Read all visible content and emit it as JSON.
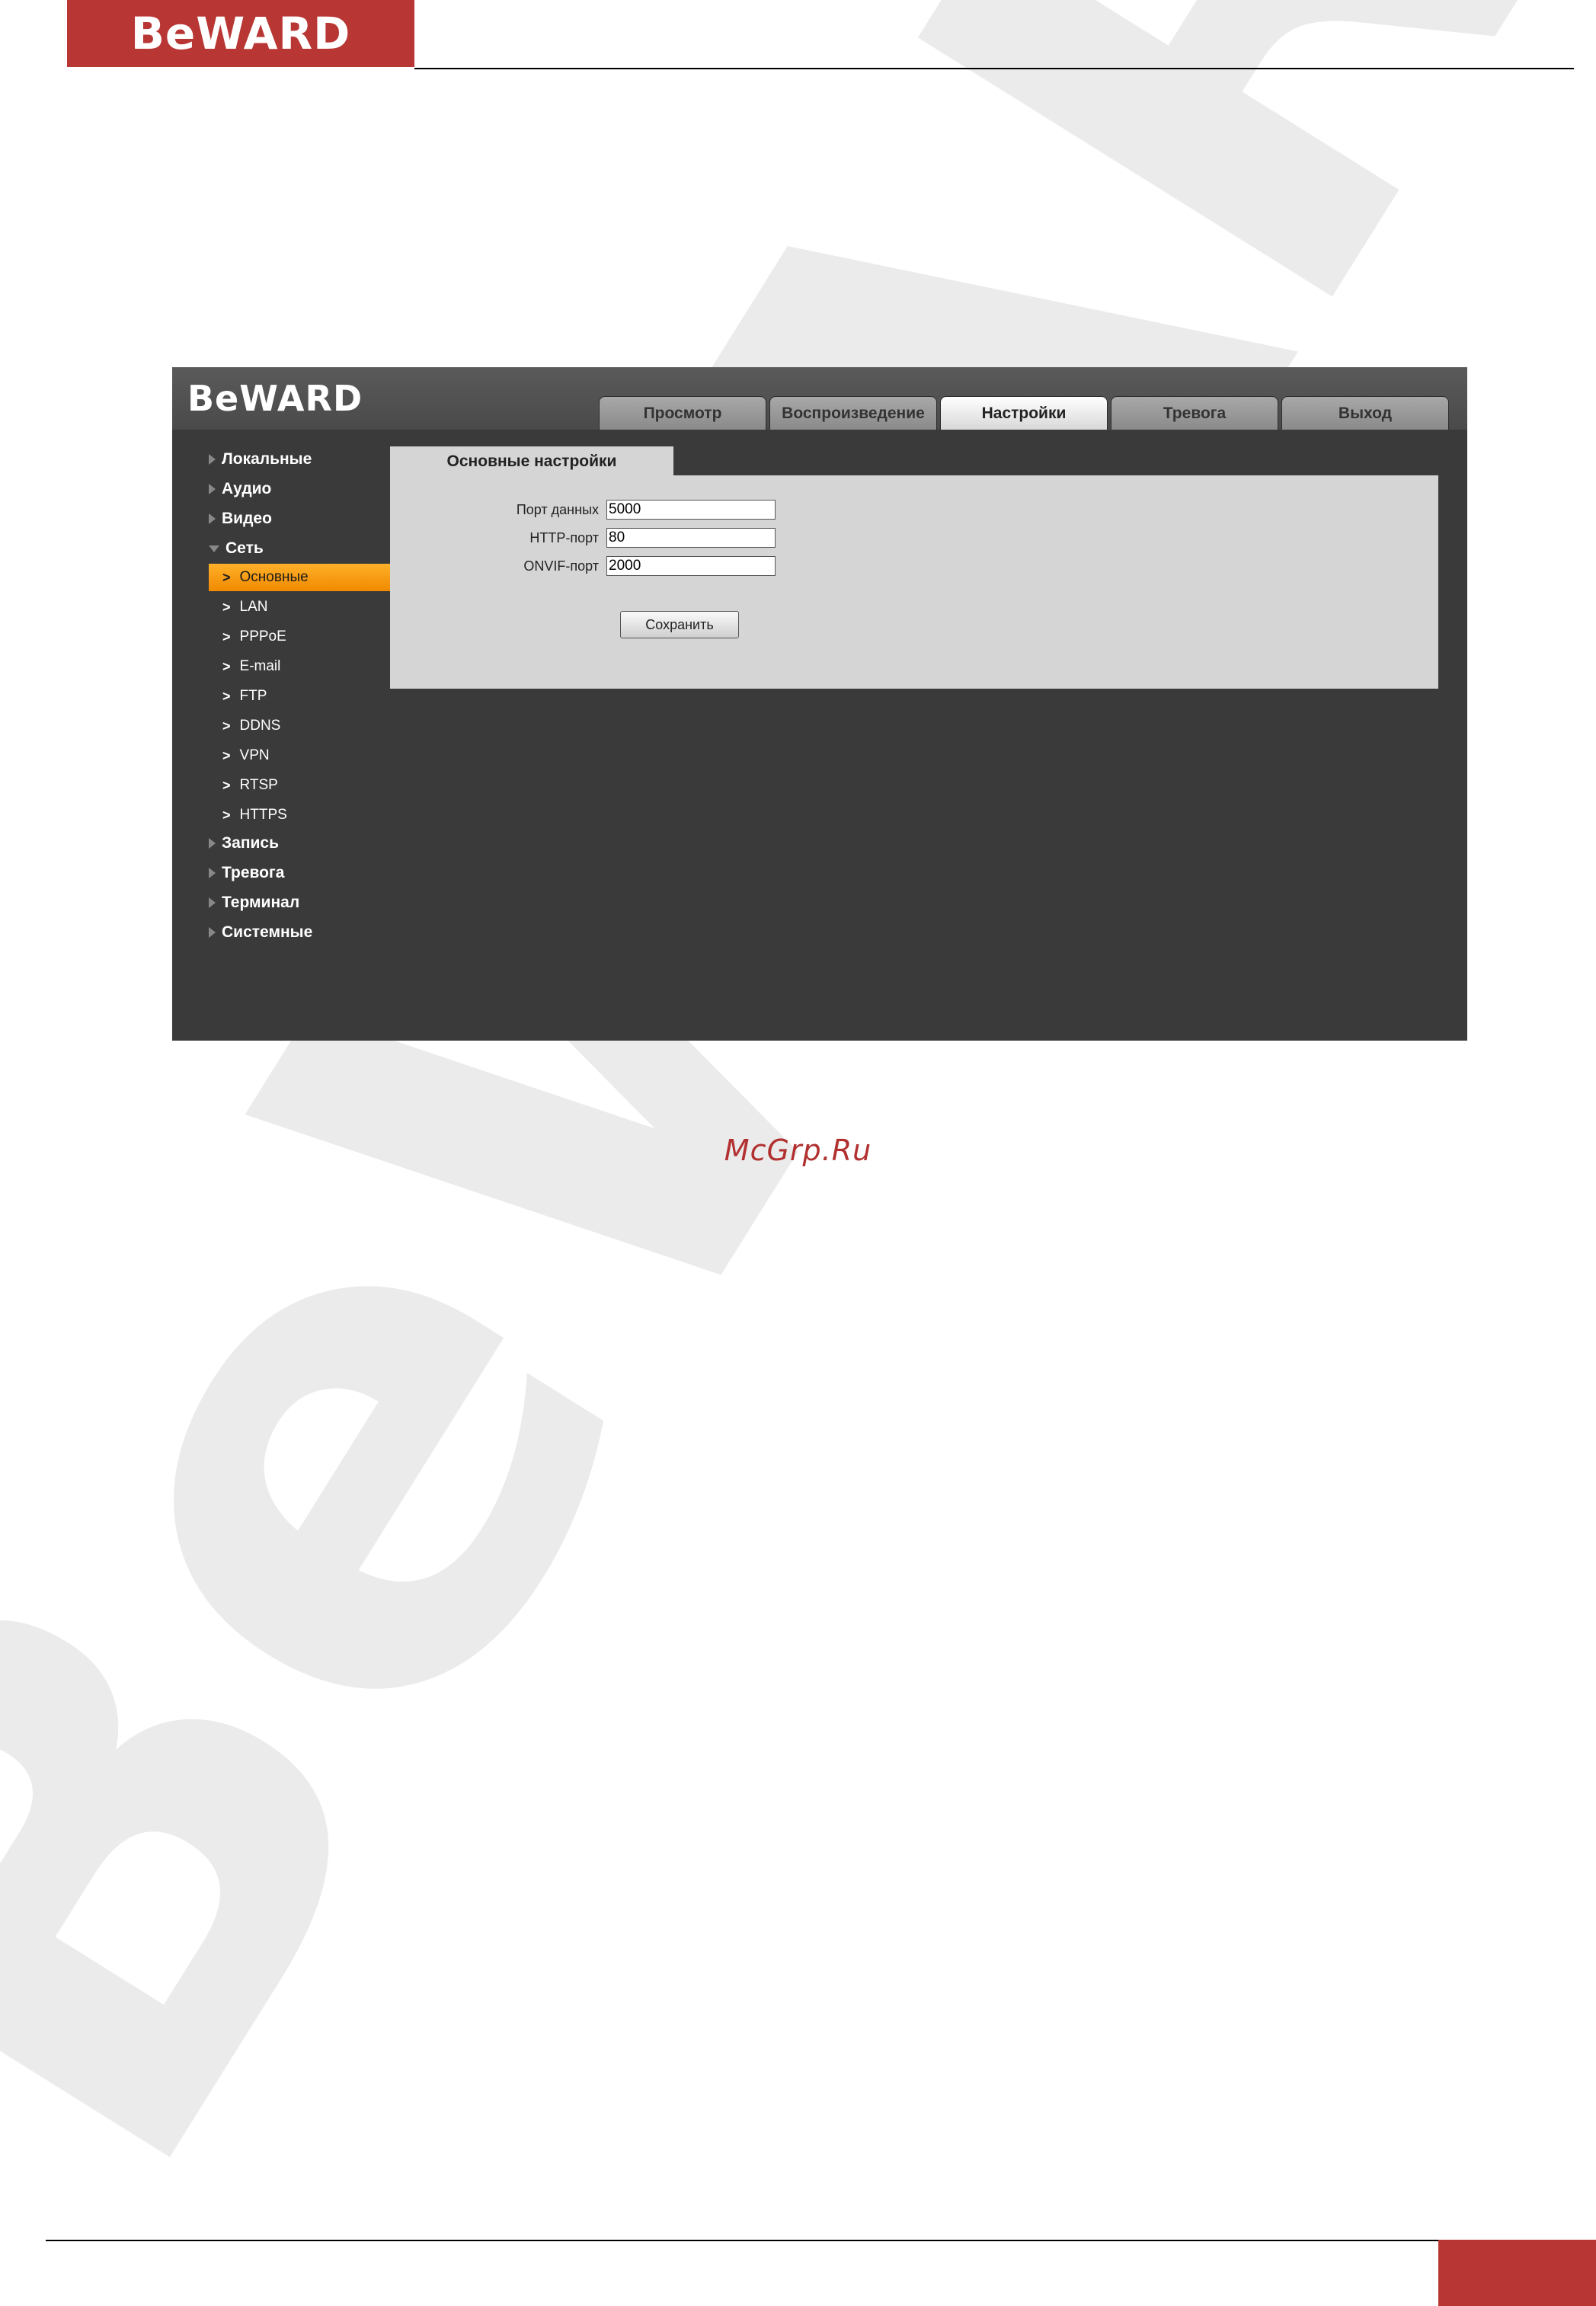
{
  "doc": {
    "logo_text": "BeWARD",
    "watermark_text": "BeWARD",
    "site_watermark": "McGrp.Ru"
  },
  "app": {
    "logo_text": "BeWARD",
    "tabs": [
      {
        "label": "Просмотр",
        "active": false
      },
      {
        "label": "Воспроизведение",
        "active": false
      },
      {
        "label": "Настройки",
        "active": true
      },
      {
        "label": "Тревога",
        "active": false
      },
      {
        "label": "Выход",
        "active": false
      }
    ],
    "sidebar": {
      "groups": [
        {
          "label": "Локальные",
          "expanded": false
        },
        {
          "label": "Аудио",
          "expanded": false
        },
        {
          "label": "Видео",
          "expanded": false
        },
        {
          "label": "Сеть",
          "expanded": true
        },
        {
          "label": "Запись",
          "expanded": false
        },
        {
          "label": "Тревога",
          "expanded": false
        },
        {
          "label": "Терминал",
          "expanded": false
        },
        {
          "label": "Системные",
          "expanded": false
        }
      ],
      "network_items": [
        {
          "label": "Основные",
          "active": true
        },
        {
          "label": "LAN",
          "active": false
        },
        {
          "label": "PPPoE",
          "active": false
        },
        {
          "label": "E-mail",
          "active": false
        },
        {
          "label": "FTP",
          "active": false
        },
        {
          "label": "DDNS",
          "active": false
        },
        {
          "label": "VPN",
          "active": false
        },
        {
          "label": "RTSP",
          "active": false
        },
        {
          "label": "HTTPS",
          "active": false
        }
      ]
    },
    "panel": {
      "title": "Основные настройки",
      "fields": [
        {
          "label": "Порт данных",
          "value": "5000"
        },
        {
          "label": "HTTP-порт",
          "value": "80"
        },
        {
          "label": "ONVIF-порт",
          "value": "2000"
        }
      ],
      "save_label": "Сохранить"
    }
  },
  "colors": {
    "brand_red": "#b83633",
    "active_orange": "#f5a000",
    "app_bg": "#3a3a3a",
    "panel_bg": "#d5d5d5"
  }
}
